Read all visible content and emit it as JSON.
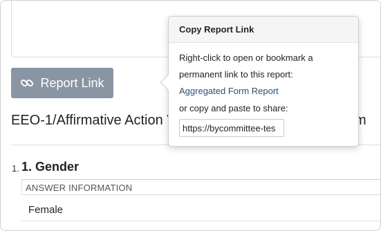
{
  "report_button": {
    "label": "Report Link",
    "icon": "link-icon"
  },
  "page_title": {
    "visible_start": "EEO-1/Affirmative Action V",
    "visible_tail": "m"
  },
  "question": {
    "number": "1.",
    "title": "1. Gender"
  },
  "answers": {
    "header": "ANSWER INFORMATION",
    "rows": [
      "Female"
    ]
  },
  "popover": {
    "title": "Copy Report Link",
    "line1": "Right-click to open or bookmark a",
    "line2": "permanent link to this report:",
    "link_text": "Aggregated Form Report",
    "line3": "or copy and paste to share:",
    "url_value": "https://bycommittee-tes"
  },
  "colors": {
    "button_bg": "#8a95a4",
    "link": "#2c4f75",
    "popover_head_bg": "#f5f5f5"
  }
}
